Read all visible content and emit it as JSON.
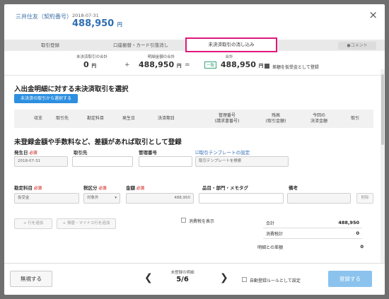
{
  "header": {
    "account_name": "三井住友（契約番号）",
    "date": "2018-07-31",
    "amount": "488,950",
    "amount_unit": "円",
    "close_label": "×"
  },
  "tabs": [
    {
      "label": "取引登録"
    },
    {
      "label": "口座振替・カード引落消し"
    },
    {
      "label": "未決済取引の消し込み"
    }
  ],
  "comment_label": "●コメント",
  "summary": {
    "unsettled_total_label": "未決済取引の合計",
    "unsettled_total_value": "0",
    "statement_total_label": "明細金額の合計",
    "statement_total_value": "488,950",
    "sum_label": "合計",
    "match_badge": "一致",
    "sum_value": "488,950",
    "unit": "円",
    "plus": "+",
    "equals": "=",
    "register_as_advance_label": "差額を仮受金として登録",
    "register_as_advance_checked": true
  },
  "select_section": {
    "title": "入出金明細に対する未決済取引を選択",
    "select_button": "未決済の取引から選択する",
    "columns": [
      "収支",
      "取引先",
      "勘定科目",
      "発生日",
      "決済期日",
      "管理番号\n(請求書番号)",
      "残高\n(取引金額)",
      "今回の\n決済金額",
      "取引"
    ]
  },
  "register_section": {
    "title": "未登録金額や手数料など、差額があれば取引として登録",
    "date_label": "発生日",
    "required": "必須",
    "date_value": "2018-07-31",
    "partner_label": "取引先",
    "partner_value": "",
    "mgmt_label": "管理番号",
    "mgmt_value": "",
    "template_link": "取引テンプレートの設定",
    "template_placeholder": "取引テンプレートを検索",
    "account_label": "勘定科目",
    "tax_label": "税区分",
    "amount_label": "金額",
    "item_label": "品目・部門・メモタグ",
    "note_label": "備考",
    "account_value": "仮受金",
    "tax_value": "対象外",
    "amount_value": "488,950",
    "item_value": "",
    "note_value": "",
    "delete_label": "削除",
    "add_row_label": "+ 行を追加",
    "add_adjust_label": "+ 振替・マイナス行を追加",
    "show_tax_label": "消費税を表示",
    "show_tax_checked": false
  },
  "totals": {
    "total_label": "合計",
    "total_value": "488,950",
    "tax_label": "消費税計",
    "tax_value": "0",
    "diff_label": "明細との差額",
    "diff_value": "0"
  },
  "footer": {
    "ignore_label": "無視する",
    "pagination_label": "未登録の明細",
    "pagination_value": "5/6",
    "prev_arrow": "❮",
    "next_arrow": "❯",
    "auto_rule_label": "自動登録ルールとして設定",
    "auto_rule_checked": false,
    "register_label": "登録する"
  }
}
